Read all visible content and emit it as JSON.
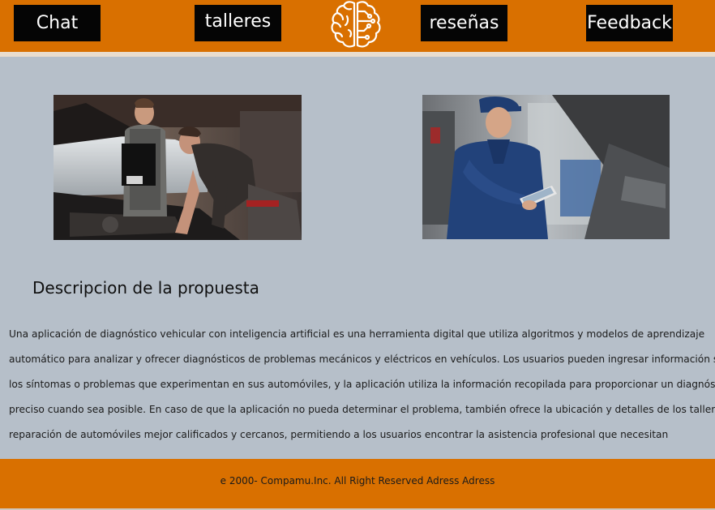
{
  "nav": {
    "chat": "Chat",
    "talleres": "talleres",
    "resenas": "reseñas",
    "feedback": "Feedback",
    "logo_icon": "brain-circuit-icon"
  },
  "colors": {
    "brand_orange": "#d97000",
    "page_background": "#b6bfc9",
    "nav_button": "#050505"
  },
  "images": {
    "left": "mechanics-inspecting-engine-photo",
    "right": "mechanic-with-tablet-photo"
  },
  "content": {
    "title": "Descripcion de la propuesta",
    "lines": [
      "Una aplicación de diagnóstico vehicular con inteligencia artificial es una herramienta digital que utiliza algoritmos y modelos de aprendizaje",
      "automático para analizar y ofrecer diagnósticos de problemas mecánicos y eléctricos en  vehículos. Los usuarios pueden ingresar información sobre",
      "los síntomas o problemas que experimentan en sus automóviles, y la aplicación utiliza la información recopilada para proporcionar un diagnóstico",
      "preciso cuando sea posible. En caso de que la aplicación no pueda determinar el problema, también ofrece la ubicación y detalles de los talleres de",
      "reparación de automóviles mejor calificados y cercanos, permitiendo a los usuarios encontrar la asistencia profesional que necesitan"
    ]
  },
  "footer": {
    "text": "e 2000- Compamu.Inc. All Right Reserved Adress Adress"
  }
}
